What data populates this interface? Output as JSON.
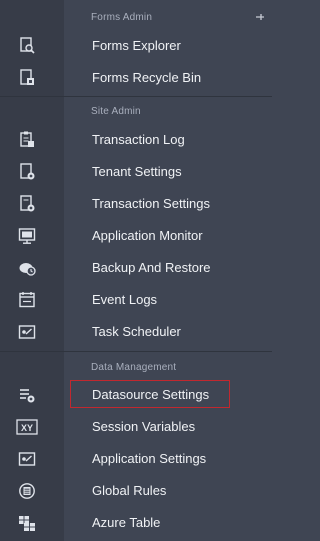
{
  "sections": [
    {
      "header": "Forms Admin",
      "items": [
        {
          "label": "Forms Explorer",
          "icon": "form-search-icon"
        },
        {
          "label": "Forms Recycle Bin",
          "icon": "form-recycle-icon"
        }
      ]
    },
    {
      "header": "Site Admin",
      "items": [
        {
          "label": "Transaction Log",
          "icon": "transaction-log-icon"
        },
        {
          "label": "Tenant Settings",
          "icon": "tenant-settings-icon"
        },
        {
          "label": "Transaction Settings",
          "icon": "transaction-settings-icon"
        },
        {
          "label": "Application Monitor",
          "icon": "monitor-icon"
        },
        {
          "label": "Backup And Restore",
          "icon": "backup-restore-icon"
        },
        {
          "label": "Event Logs",
          "icon": "event-logs-icon"
        },
        {
          "label": "Task Scheduler",
          "icon": "task-scheduler-icon"
        }
      ]
    },
    {
      "header": "Data Management",
      "items": [
        {
          "label": "Datasource Settings",
          "icon": "datasource-settings-icon",
          "selected": true
        },
        {
          "label": "Session Variables",
          "icon": "session-variables-icon",
          "icon_text": "XY"
        },
        {
          "label": "Application Settings",
          "icon": "application-settings-icon"
        },
        {
          "label": "Global Rules",
          "icon": "global-rules-icon"
        },
        {
          "label": "Azure Table",
          "icon": "azure-table-icon"
        }
      ]
    }
  ],
  "colors": {
    "background": "#3f4553",
    "rail": "#373c48",
    "text": "#f0f2f5",
    "header_text": "#a9afbd",
    "selection_border": "#c2282f"
  }
}
